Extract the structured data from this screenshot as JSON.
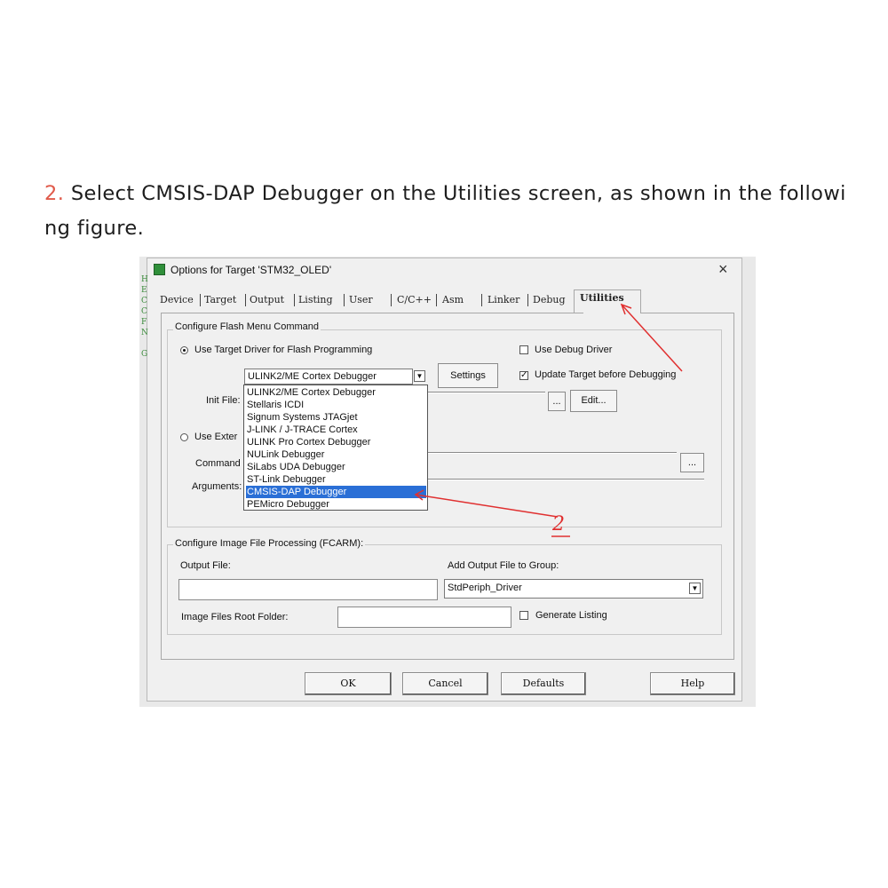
{
  "caption": {
    "number": "2.",
    "line1": "Select CMSIS-DAP Debugger on the Utilities screen, as shown in the followi",
    "line2": "ng figure."
  },
  "window": {
    "title": "Options for Target 'STM32_OLED'",
    "close_glyph": "×",
    "left_edge_letters": "H\nE\nC\nC\nF\nN\n\nG"
  },
  "tabs": [
    "Device",
    "Target",
    "Output",
    "Listing",
    "User",
    "C/C++",
    "Asm",
    "Linker",
    "Debug",
    "Utilities"
  ],
  "flash_group": {
    "legend": "Configure Flash Menu Command",
    "use_target_driver": "Use Target Driver for Flash Programming",
    "use_debug_driver": "Use Debug Driver",
    "update_target": "Update Target before Debugging",
    "update_target_checked": "✓",
    "driver_selected": "ULINK2/ME Cortex Debugger",
    "settings_button": "Settings",
    "init_file_label": "Init File:",
    "browse_button": "...",
    "edit_button": "Edit...",
    "use_external_label": "Use Exter",
    "command_label": "Command",
    "arguments_label": "Arguments:",
    "browse_button2": "...",
    "driver_options": [
      "ULINK2/ME Cortex Debugger",
      "Stellaris ICDI",
      "Signum Systems JTAGjet",
      "J-LINK / J-TRACE Cortex",
      "ULINK Pro Cortex Debugger",
      "NULink Debugger",
      "SiLabs UDA Debugger",
      "ST-Link Debugger",
      "CMSIS-DAP Debugger",
      "PEMicro Debugger"
    ],
    "selected_index": 8
  },
  "image_group": {
    "legend": "Configure Image File Processing (FCARM):",
    "output_file_label": "Output File:",
    "add_output_label": "Add Output File to Group:",
    "group_selected": "StdPeriph_Driver",
    "root_folder_label": "Image Files Root Folder:",
    "generate_listing": "Generate Listing"
  },
  "buttons": {
    "ok": "OK",
    "cancel": "Cancel",
    "defaults": "Defaults",
    "help": "Help"
  },
  "annotation": {
    "label": "2",
    "color": "#e03030"
  },
  "dropdown_glyph": "▼",
  "colors": {
    "selection": "#2a6fd6",
    "caption_number": "#e05a4a",
    "arrow": "#e03030"
  }
}
